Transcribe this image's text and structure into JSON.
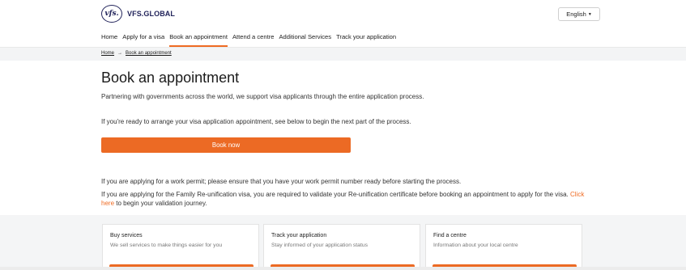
{
  "header": {
    "logo_mark": "vfs.",
    "logo_text": "VFS.GLOBAL",
    "language": "English",
    "nav": [
      {
        "label": "Home"
      },
      {
        "label": "Apply for a visa"
      },
      {
        "label": "Book an appointment",
        "active": true
      },
      {
        "label": "Attend a centre"
      },
      {
        "label": "Additional Services"
      },
      {
        "label": "Track your application"
      }
    ]
  },
  "breadcrumb": {
    "home": "Home",
    "separator": "→",
    "current": "Book an appointment"
  },
  "main": {
    "title": "Book an appointment",
    "intro": "Partnering with governments across the world, we support visa applicants through the entire application process.",
    "ready": "If you're ready to arrange your visa application appointment, see below to begin the next part of the process.",
    "book_label": "Book now",
    "work_permit": "If you are applying for a work permit; please ensure that you have your work permit number ready before starting the process.",
    "family_pre": "If you are applying for the Family Re-unification visa, you are required to validate your Re-unification certificate before booking an appointment to apply for the visa. ",
    "family_link": "Click here",
    "family_post": " to begin your validation journey."
  },
  "cards": [
    {
      "title": "Buy services",
      "desc": "We sell services to make things easier for you"
    },
    {
      "title": "Track your application",
      "desc": "Stay informed of your application status"
    },
    {
      "title": "Find a centre",
      "desc": "Information about your local centre"
    }
  ],
  "colors": {
    "accent": "#ec6a24",
    "brand": "#22245b"
  }
}
